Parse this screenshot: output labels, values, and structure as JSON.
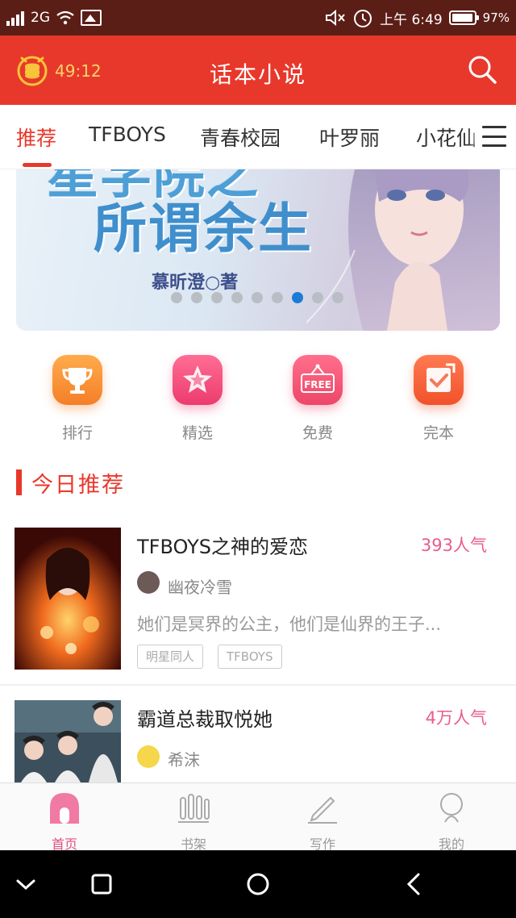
{
  "status_bar": {
    "network": "2G",
    "time": "上午 6:49",
    "battery": "97%",
    "sim_slots": "21"
  },
  "header": {
    "timer": "49:12",
    "title": "话本小说",
    "icons": [
      "gold-coin-icon",
      "search-icon"
    ],
    "brand_color": "#e8382b"
  },
  "tabs": {
    "items": [
      "推荐",
      "TFBOYS",
      "青春校园",
      "叶罗丽",
      "小花仙"
    ],
    "active_index": 0
  },
  "banner": {
    "title_line1": "星学院之",
    "title_line2": "所谓余生",
    "author": "慕昕澄○著",
    "slide_count": 9,
    "active_slide": 7
  },
  "quick_links": [
    {
      "label": "排行",
      "icon": "trophy-icon",
      "color": "#f7903c"
    },
    {
      "label": "精选",
      "icon": "star-icon",
      "color": "#f14f7e"
    },
    {
      "label": "免费",
      "icon": "free-sign-icon",
      "color": "#f2567a",
      "sign_text": "FREE"
    },
    {
      "label": "完本",
      "icon": "checkbox-icon",
      "color": "#f45e3d"
    }
  ],
  "section": {
    "title": "今日推荐"
  },
  "books": [
    {
      "title": "TFBOYS之神的爱恋",
      "popularity": "393人气",
      "author": "幽夜冷雪",
      "description": "她们是冥界的公主，他们是仙界的王子...",
      "tags": [
        "明星同人",
        "TFBOYS"
      ]
    },
    {
      "title": "霸道总裁取悦她",
      "popularity": "4万人气",
      "author": "希沫"
    }
  ],
  "bottom_nav": {
    "items": [
      {
        "label": "首页",
        "icon": "home-icon"
      },
      {
        "label": "书架",
        "icon": "bookshelf-icon"
      },
      {
        "label": "写作",
        "icon": "pen-icon"
      },
      {
        "label": "我的",
        "icon": "profile-icon"
      }
    ],
    "active_index": 0,
    "active_color": "#e05080"
  },
  "system_nav": [
    "collapse-icon",
    "recent-apps-icon",
    "home-circle-icon",
    "back-icon"
  ]
}
